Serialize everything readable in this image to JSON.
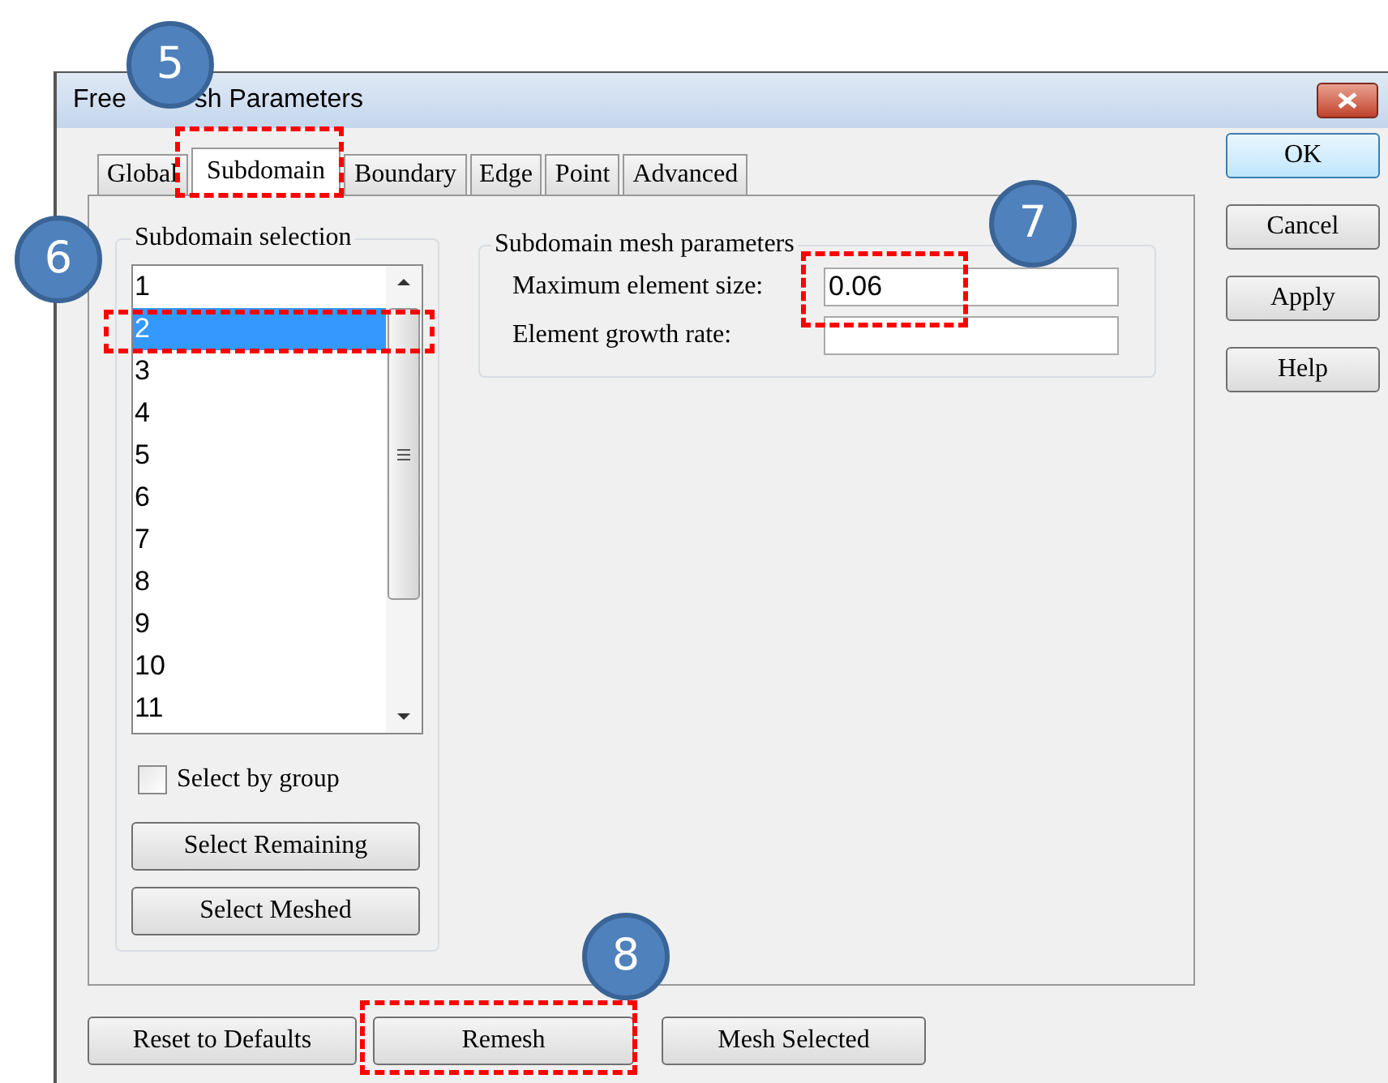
{
  "window": {
    "title_parts": [
      "Free",
      "sh Parameters"
    ]
  },
  "tabs": [
    {
      "label": "Global",
      "selected": false
    },
    {
      "label": "Subdomain",
      "selected": true
    },
    {
      "label": "Boundary",
      "selected": false
    },
    {
      "label": "Edge",
      "selected": false
    },
    {
      "label": "Point",
      "selected": false
    },
    {
      "label": "Advanced",
      "selected": false
    }
  ],
  "selection_group": {
    "title": "Subdomain selection",
    "items": [
      {
        "label": "1",
        "selected": false
      },
      {
        "label": "2",
        "selected": true
      },
      {
        "label": "3",
        "selected": false
      },
      {
        "label": "4",
        "selected": false
      },
      {
        "label": "5",
        "selected": false
      },
      {
        "label": "6",
        "selected": false
      },
      {
        "label": "7",
        "selected": false
      },
      {
        "label": "8",
        "selected": false
      },
      {
        "label": "9",
        "selected": false
      },
      {
        "label": "10",
        "selected": false
      },
      {
        "label": "11",
        "selected": false
      }
    ],
    "select_by_group": {
      "label": "Select by group",
      "checked": false
    },
    "buttons": [
      "Select Remaining",
      "Select Meshed"
    ]
  },
  "mesh_group": {
    "title": "Subdomain mesh parameters",
    "fields": [
      {
        "label": "Maximum element size:",
        "value": "0.06"
      },
      {
        "label": "Element growth rate:"
      }
    ]
  },
  "side_buttons": [
    {
      "label": "OK",
      "default": true
    },
    {
      "label": "Cancel",
      "default": false
    },
    {
      "label": "Apply",
      "default": false
    },
    {
      "label": "Help",
      "default": false
    }
  ],
  "bottom_buttons": [
    "Reset to Defaults",
    "Remesh",
    "Mesh Selected"
  ],
  "callouts": [
    {
      "number": "5"
    },
    {
      "number": "6"
    },
    {
      "number": "7"
    },
    {
      "number": "8"
    }
  ]
}
